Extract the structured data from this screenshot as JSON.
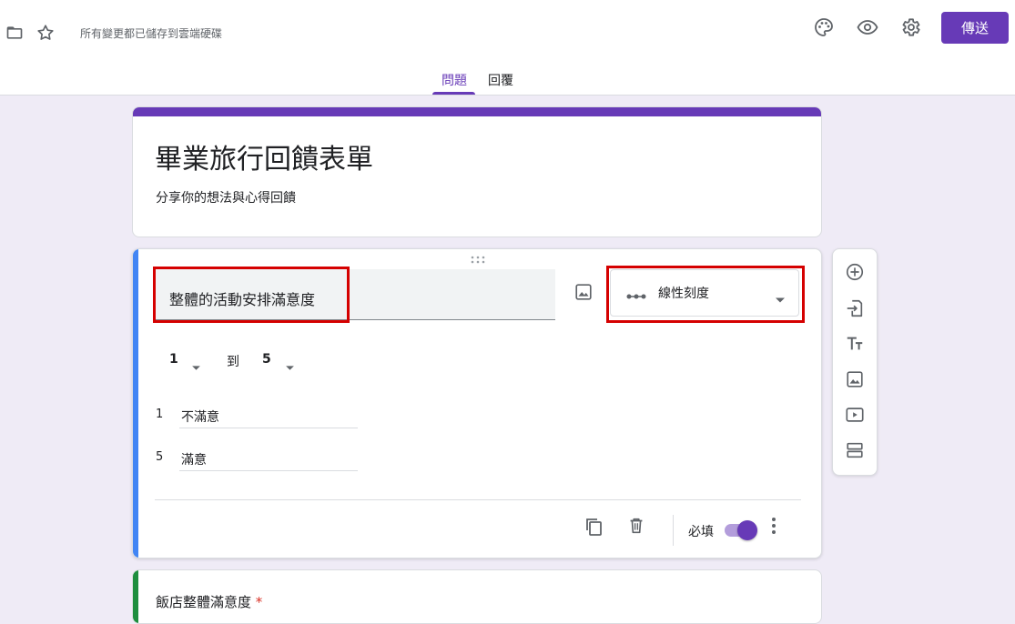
{
  "header": {
    "saved_status": "所有變更都已儲存到雲端硬碟",
    "send_label": "傳送",
    "tabs": [
      {
        "label": "問題",
        "active": true
      },
      {
        "label": "回覆",
        "active": false
      }
    ],
    "icons": [
      "folder-icon",
      "star-icon",
      "palette-icon",
      "preview-eye-icon",
      "settings-gear-icon"
    ]
  },
  "form": {
    "title": "畢業旅行回饋表單",
    "description": "分享你的想法與心得回饋"
  },
  "question": {
    "text": "整體的活動安排滿意度",
    "type_label": "線性刻度",
    "range_from": "1",
    "range_to_label": "到",
    "range_to": "5",
    "scale": [
      {
        "num": "1",
        "label": "不滿意"
      },
      {
        "num": "5",
        "label": "滿意"
      }
    ],
    "required_label": "必填",
    "required": true
  },
  "next_question": {
    "text": "飯店整體滿意度",
    "required_mark": "*"
  },
  "colors": {
    "accent": "#673ab7",
    "active_bar": "#4285f4",
    "highlight_box": "#d50000"
  }
}
